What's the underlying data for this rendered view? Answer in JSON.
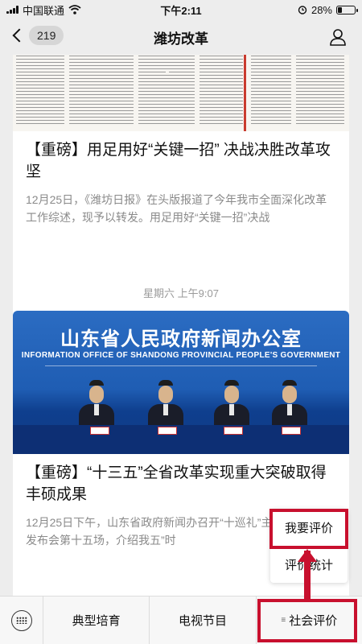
{
  "status_bar": {
    "carrier": "中国联通",
    "time": "下午2:11",
    "battery": "28%",
    "battery_level": 0.28
  },
  "nav": {
    "unread_count": "219",
    "title": "潍坊改革"
  },
  "feed": {
    "articles": [
      {
        "title": "【重磅】用足用好“关键一招” 决战决胜改革攻坚",
        "desc": "12月25日，《潍坊日报》在头版报道了今年我市全面深化改革工作综述，现予以转发。用足用好“关键一招”决战"
      },
      {
        "title": "【重磅】“十三五”全省改革实现重大突破取得丰硕成果",
        "desc": "12月25日下午，山东省政府新闻办召开“十巡礼”主题系列新闻发布会第十五场，介绍我五”时"
      }
    ],
    "timestamp": "星期六 上午9:07",
    "photo": {
      "title": "山东省人民政府新闻办公室",
      "subtitle": "INFORMATION OFFICE OF SHANDONG PROVINCIAL PEOPLE'S GOVERNMENT"
    }
  },
  "popup": {
    "items": [
      "我要评价",
      "评价统计"
    ]
  },
  "tab_bar": {
    "tabs": [
      "典型培育",
      "电视节目",
      "社会评价"
    ]
  },
  "colors": {
    "highlight": "#c8102e",
    "background": "#ededed"
  }
}
